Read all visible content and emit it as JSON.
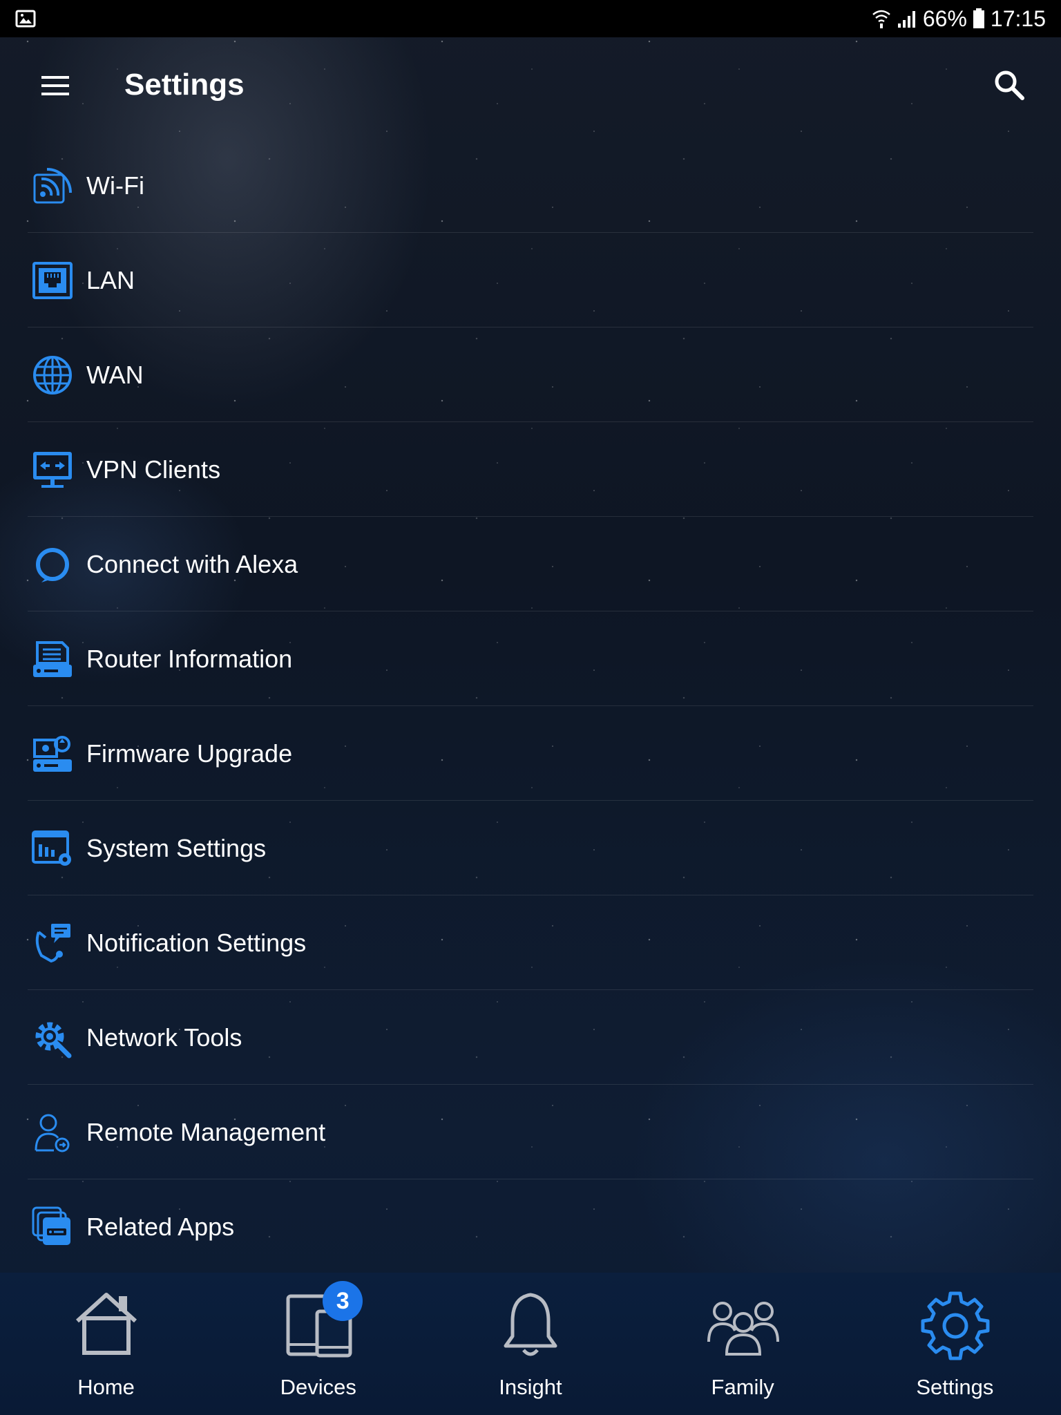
{
  "status_bar": {
    "battery": "66%",
    "time": "17:15",
    "icons": [
      "image-icon",
      "wifi-signal-icon",
      "cell-signal-icon",
      "battery-icon"
    ]
  },
  "appbar": {
    "title": "Settings",
    "icons": [
      "menu-icon",
      "search-icon"
    ]
  },
  "settings": {
    "items": [
      {
        "label": "Wi-Fi",
        "icon": "wifi-icon"
      },
      {
        "label": "LAN",
        "icon": "lan-port-icon"
      },
      {
        "label": "WAN",
        "icon": "globe-icon"
      },
      {
        "label": "VPN Clients",
        "icon": "vpn-monitor-icon"
      },
      {
        "label": "Connect with Alexa",
        "icon": "alexa-icon"
      },
      {
        "label": "Router Information",
        "icon": "router-info-icon"
      },
      {
        "label": "Firmware Upgrade",
        "icon": "firmware-upgrade-icon"
      },
      {
        "label": "System Settings",
        "icon": "system-settings-icon"
      },
      {
        "label": "Notification Settings",
        "icon": "notification-settings-icon"
      },
      {
        "label": "Network Tools",
        "icon": "network-tools-icon"
      },
      {
        "label": "Remote Management",
        "icon": "remote-management-icon"
      },
      {
        "label": "Related Apps",
        "icon": "related-apps-icon"
      }
    ]
  },
  "bottom_nav": {
    "items": [
      {
        "label": "Home",
        "icon": "home-icon",
        "active": false
      },
      {
        "label": "Devices",
        "icon": "devices-icon",
        "active": false,
        "badge": "3"
      },
      {
        "label": "Insight",
        "icon": "bell-icon",
        "active": false
      },
      {
        "label": "Family",
        "icon": "family-icon",
        "active": false
      },
      {
        "label": "Settings",
        "icon": "gear-icon",
        "active": true
      }
    ]
  },
  "colors": {
    "accent": "#2a8cf0",
    "badge": "#1b74e8",
    "nav_inactive": "#b8bcc4",
    "statusbar": "#000000",
    "nav_background": "#0b1f3d"
  }
}
